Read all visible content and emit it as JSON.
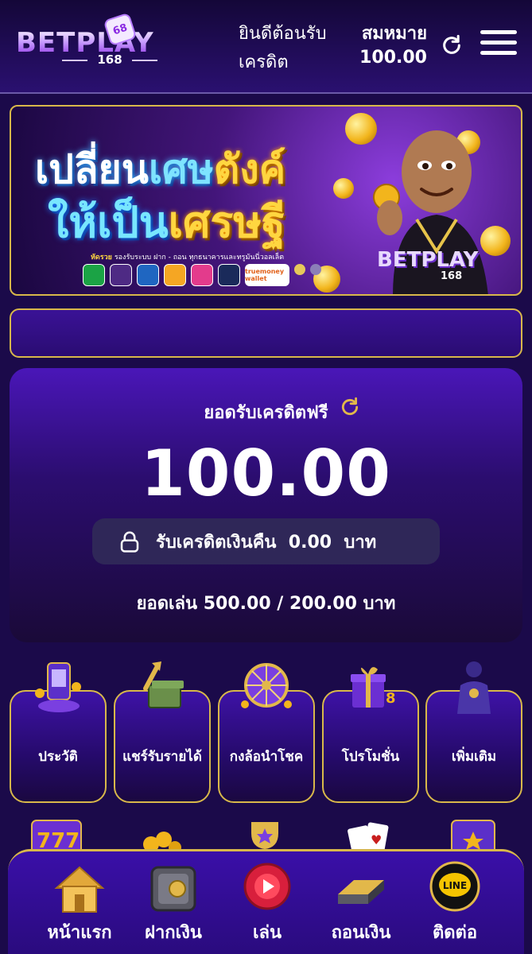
{
  "header": {
    "logo_text": "BETPLAY",
    "logo_sub": "168",
    "logo_dice": "68",
    "welcome": "ยินดีต้อนรับ",
    "username": "สมหมาย",
    "credit_label": "เครดิต",
    "balance": "100.00",
    "refresh_icon": "refresh-icon",
    "menu_icon": "hamburger-menu-icon"
  },
  "banner": {
    "line1_white": "เปลี่ยน",
    "line1_blue": "เศษ",
    "line1_gold": "ตังค์",
    "line2_blue": "ให้เป็น",
    "line2_gold": "เศรษฐี",
    "note_bold": "หัดรวย",
    "note": " รองรับระบบ ฝาก - ถอน ทุกธนาคารและทรูมันนี่วอลเล็ต",
    "truemoney": "truemoney wallet",
    "logo_text": "BETPLAY",
    "logo_sub": "168",
    "bank_colors": [
      "#1ba345",
      "#4e2a84",
      "#1f66c1",
      "#f5a623",
      "#e33b8c",
      "#1a2a5a"
    ]
  },
  "credit": {
    "title": "ยอดรับเครดิตฟรี",
    "amount": "100.00",
    "cashback_label": "รับเครดิตเงินคืน",
    "cashback_value": "0.00",
    "cashback_unit": "บาท",
    "turnover": "ยอดเล่น 500.00 / 200.00 บาท"
  },
  "tiles": [
    {
      "label": "ประวัติ",
      "icon": "history-phone-icon"
    },
    {
      "label": "แชร์รับรายได้",
      "icon": "money-stack-arrow-icon"
    },
    {
      "label": "กงล้อนำโชค",
      "icon": "lucky-wheel-icon"
    },
    {
      "label": "โปรโมชั่น",
      "icon": "gift-box-icon"
    },
    {
      "label": "เพิ่มเติม",
      "icon": "more-character-icon"
    }
  ],
  "bottom_nav": [
    {
      "label": "หน้าแรก",
      "icon": "home-icon"
    },
    {
      "label": "ฝากเงิน",
      "icon": "safe-icon"
    },
    {
      "label": "เล่น",
      "icon": "play-button-icon"
    },
    {
      "label": "ถอนเงิน",
      "icon": "gold-bar-icon"
    },
    {
      "label": "ติดต่อ",
      "icon": "line-icon"
    }
  ],
  "line_badge": "LINE",
  "colors": {
    "gold_border": "#d8b84a",
    "purple_dark": "#1b0a4a",
    "purple_mid": "#3a0fa8"
  }
}
